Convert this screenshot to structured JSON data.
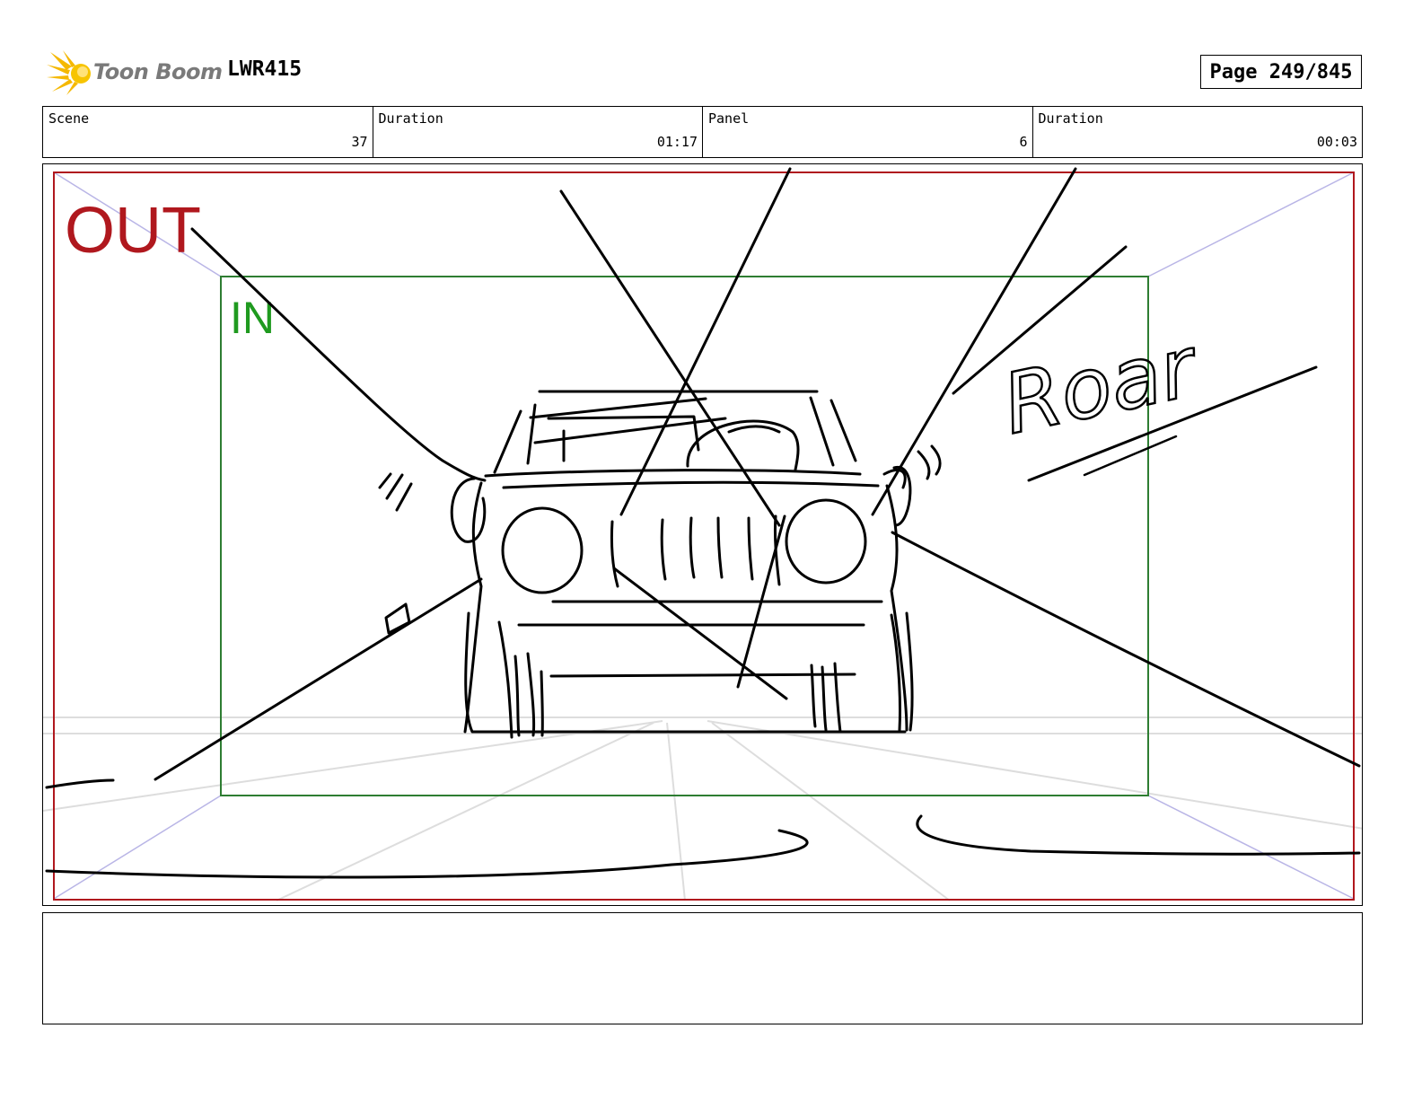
{
  "header": {
    "logo_text": "Toon Boom",
    "project": "LWR415",
    "page": "Page 249/845"
  },
  "info": {
    "scene_label": "Scene",
    "scene_value": "37",
    "scene_duration_label": "Duration",
    "scene_duration_value": "01:17",
    "panel_label": "Panel",
    "panel_value": "6",
    "panel_duration_label": "Duration",
    "panel_duration_value": "00:03"
  },
  "panel": {
    "out_label": "OUT",
    "in_label": "IN",
    "sfx_text": "Roar",
    "out_color": "#b0181e",
    "in_color": "#1f9a1f"
  },
  "notes": {
    "text": ""
  }
}
